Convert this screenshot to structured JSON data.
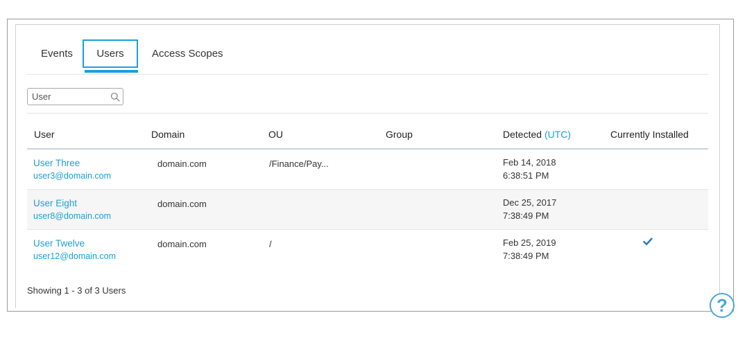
{
  "tabs": {
    "events": "Events",
    "users": "Users",
    "access_scopes": "Access Scopes",
    "active": "Users"
  },
  "search": {
    "placeholder": "User",
    "value": ""
  },
  "table": {
    "columns": {
      "user": "User",
      "domain": "Domain",
      "ou": "OU",
      "group": "Group",
      "detected": "Detected",
      "detected_suffix": "(UTC)",
      "installed": "Currently Installed"
    },
    "rows": [
      {
        "name": "User Three",
        "email": "user3@domain.com",
        "domain": "domain.com",
        "ou": "/Finance/Pay...",
        "group": "",
        "detected_date": "Feb 14, 2018",
        "detected_time": "6:38:51 PM",
        "installed": false
      },
      {
        "name": "User Eight",
        "email": "user8@domain.com",
        "domain": "domain.com",
        "ou": "",
        "group": "",
        "detected_date": "Dec 25, 2017",
        "detected_time": "7:38:49 PM",
        "installed": false
      },
      {
        "name": "User Twelve",
        "email": "user12@domain.com",
        "domain": "domain.com",
        "ou": "/",
        "group": "",
        "detected_date": "Feb 25, 2019",
        "detected_time": "7:38:49 PM",
        "installed": true
      }
    ]
  },
  "footer": {
    "showing": "Showing 1 - 3 of 3 Users"
  },
  "help": {
    "glyph": "?",
    "icon": "help-circle-icon"
  },
  "colors": {
    "accent": "#1ba0d7",
    "help": "#4aa6d8",
    "check": "#2a7fc1"
  }
}
